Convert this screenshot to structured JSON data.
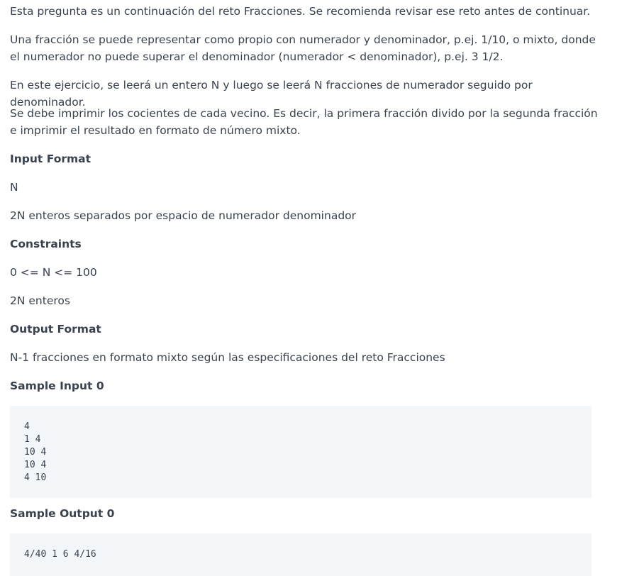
{
  "intro": {
    "p1": "Esta pregunta es un continuación del reto Fracciones. Se recomienda revisar ese reto antes de continuar.",
    "p2": "Una fracción se puede representar como propio con numerador y denominador, p.ej. 1/10, o mixto, donde el numerador no puede superar el denominador (numerador < denominador), p.ej. 3 1/2.",
    "p3": "En este ejercicio, se leerá un entero N y luego se leerá N fracciones de numerador seguido por denominador.",
    "p4": "Se debe imprimir los cocientes de cada vecino. Es decir, la primera fracción divido por la segunda fracción e imprimir el resultado en formato de número mixto."
  },
  "input_format": {
    "heading": "Input Format",
    "line1": "N",
    "line2": "2N enteros separados por espacio de numerador denominador"
  },
  "constraints": {
    "heading": "Constraints",
    "line1": "0 <= N <= 100",
    "line2": "2N enteros"
  },
  "output_format": {
    "heading": "Output Format",
    "line1": "N-1 fracciones en formato mixto según las especificaciones del reto Fracciones"
  },
  "sample_input": {
    "heading": "Sample Input 0",
    "code": "4\n1 4\n10 4\n10 4\n4 10"
  },
  "sample_output": {
    "heading": "Sample Output 0",
    "code": "4/40 1 6 4/16"
  }
}
